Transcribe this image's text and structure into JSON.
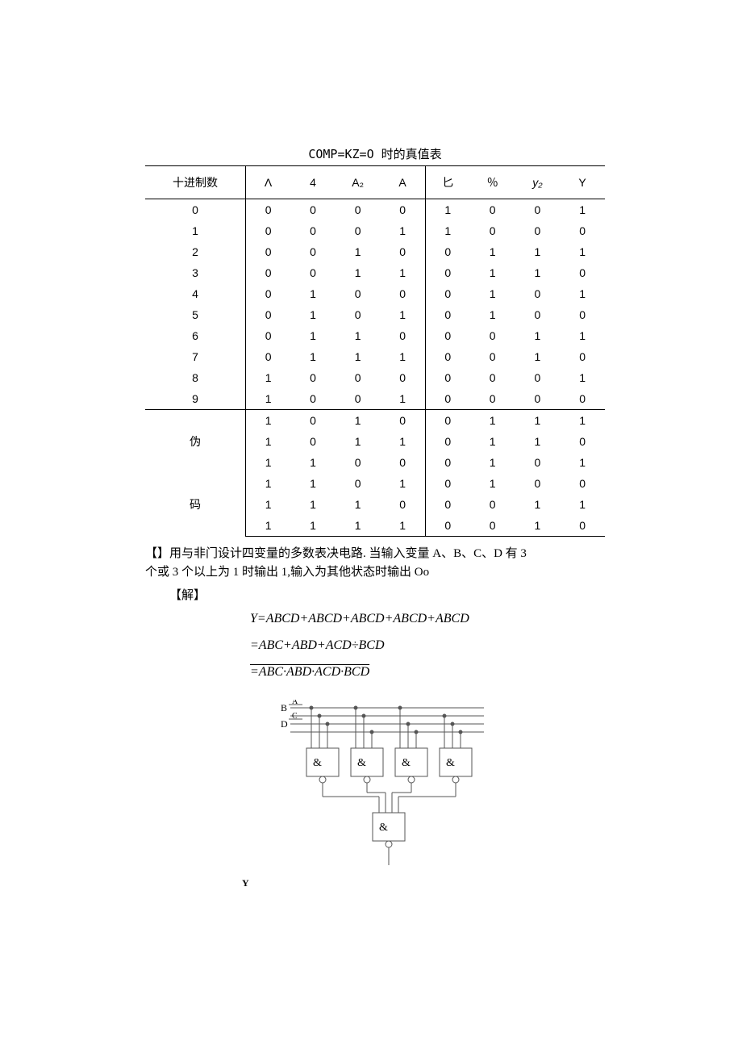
{
  "table_title": "COMP=KZ=O 时的真值表",
  "headers": {
    "dec": "十进制数",
    "a3": "Λ",
    "a2": "4",
    "a1": "A₂",
    "a0": "A",
    "y3": "匕",
    "y2": "％",
    "y1": "y₂",
    "y0": "Y"
  },
  "row_labels": {
    "wei": "伪",
    "ma": "码"
  },
  "rows": [
    {
      "dec": "0",
      "a": [
        "0",
        "0",
        "0",
        "0"
      ],
      "y": [
        "1",
        "0",
        "0",
        "1"
      ]
    },
    {
      "dec": "1",
      "a": [
        "0",
        "0",
        "0",
        "1"
      ],
      "y": [
        "1",
        "0",
        "0",
        "0"
      ]
    },
    {
      "dec": "2",
      "a": [
        "0",
        "0",
        "1",
        "0"
      ],
      "y": [
        "0",
        "1",
        "1",
        "1"
      ]
    },
    {
      "dec": "3",
      "a": [
        "0",
        "0",
        "1",
        "1"
      ],
      "y": [
        "0",
        "1",
        "1",
        "0"
      ]
    },
    {
      "dec": "4",
      "a": [
        "0",
        "1",
        "0",
        "0"
      ],
      "y": [
        "0",
        "1",
        "0",
        "1"
      ]
    },
    {
      "dec": "5",
      "a": [
        "0",
        "1",
        "0",
        "1"
      ],
      "y": [
        "0",
        "1",
        "0",
        "0"
      ]
    },
    {
      "dec": "6",
      "a": [
        "0",
        "1",
        "1",
        "0"
      ],
      "y": [
        "0",
        "0",
        "1",
        "1"
      ]
    },
    {
      "dec": "7",
      "a": [
        "0",
        "1",
        "1",
        "1"
      ],
      "y": [
        "0",
        "0",
        "1",
        "0"
      ]
    },
    {
      "dec": "8",
      "a": [
        "1",
        "0",
        "0",
        "0"
      ],
      "y": [
        "0",
        "0",
        "0",
        "1"
      ]
    },
    {
      "dec": "9",
      "a": [
        "1",
        "0",
        "0",
        "1"
      ],
      "y": [
        "0",
        "0",
        "0",
        "0"
      ]
    }
  ],
  "extra_rows": [
    {
      "a": [
        "1",
        "0",
        "1",
        "0"
      ],
      "y": [
        "0",
        "1",
        "1",
        "1"
      ]
    },
    {
      "a": [
        "1",
        "0",
        "1",
        "1"
      ],
      "y": [
        "0",
        "1",
        "1",
        "0"
      ]
    },
    {
      "a": [
        "1",
        "1",
        "0",
        "0"
      ],
      "y": [
        "0",
        "1",
        "0",
        "1"
      ]
    },
    {
      "a": [
        "1",
        "1",
        "0",
        "1"
      ],
      "y": [
        "0",
        "1",
        "0",
        "0"
      ]
    },
    {
      "a": [
        "1",
        "1",
        "1",
        "0"
      ],
      "y": [
        "0",
        "0",
        "1",
        "1"
      ]
    },
    {
      "a": [
        "1",
        "1",
        "1",
        "1"
      ],
      "y": [
        "0",
        "0",
        "1",
        "0"
      ]
    }
  ],
  "problem": {
    "line1": "【】用与非门设计四变量的多数表决电路. 当输入变量 A、B、C、D 有 3",
    "line2": "个或 3 个以上为 1 时输出 1,输入为其他状态时输出 Oo",
    "solution_label": "【解】"
  },
  "equations": {
    "eq1": "Y=ABCD+ABCD+ABCD+ABCD+ABCD",
    "eq2": "=ABC+ABD+ACD÷BCD",
    "eq3": "=ABC·ABD·ACD·BCD"
  },
  "circuit": {
    "inputs": [
      "A",
      "B",
      "C",
      "D"
    ],
    "gate_symbol": "&",
    "bus_label_B": "B",
    "bus_label_D": "D"
  },
  "y_label": "Y"
}
